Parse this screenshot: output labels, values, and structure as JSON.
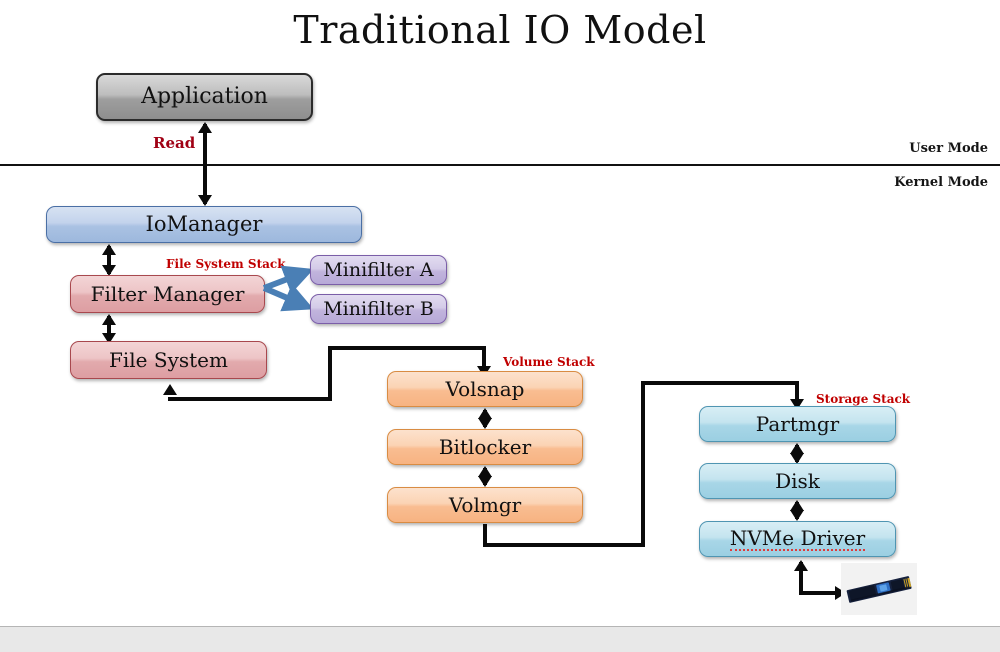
{
  "slide": {
    "title": "Traditional IO Model",
    "mode_labels": {
      "user": "User Mode",
      "kernel": "Kernel Mode"
    },
    "read_label": "Read"
  },
  "stack_labels": {
    "file_system": "File System Stack",
    "volume": "Volume Stack",
    "storage": "Storage Stack"
  },
  "boxes": {
    "application": "Application",
    "iomanager": "IoManager",
    "filter_manager": "Filter Manager",
    "minifilter_a": "Minifilter A",
    "minifilter_b": "Minifilter B",
    "file_system": "File System",
    "volsnap": "Volsnap",
    "bitlocker": "Bitlocker",
    "volmgr": "Volmgr",
    "partmgr": "Partmgr",
    "disk": "Disk",
    "nvme_driver": "NVMe Driver"
  },
  "device": {
    "name": "nvme-ssd-photo"
  },
  "colors": {
    "title_text": "#111111",
    "stack_label_red": "#c00000",
    "read_label_red": "#a00014",
    "arrow_black": "#0a0a0a",
    "fork_arrow_blue": "#4a7fb5",
    "application_fill": "#bdbdbd",
    "iomanager_fill": "#c3d3ec",
    "filter_manager_fill": "#edc4c6",
    "minifilter_fill": "#d4cbe8",
    "volume_fill": "#fbd3b4",
    "storage_fill": "#c4e4ef",
    "footer_bar": "#e8e8e8"
  }
}
